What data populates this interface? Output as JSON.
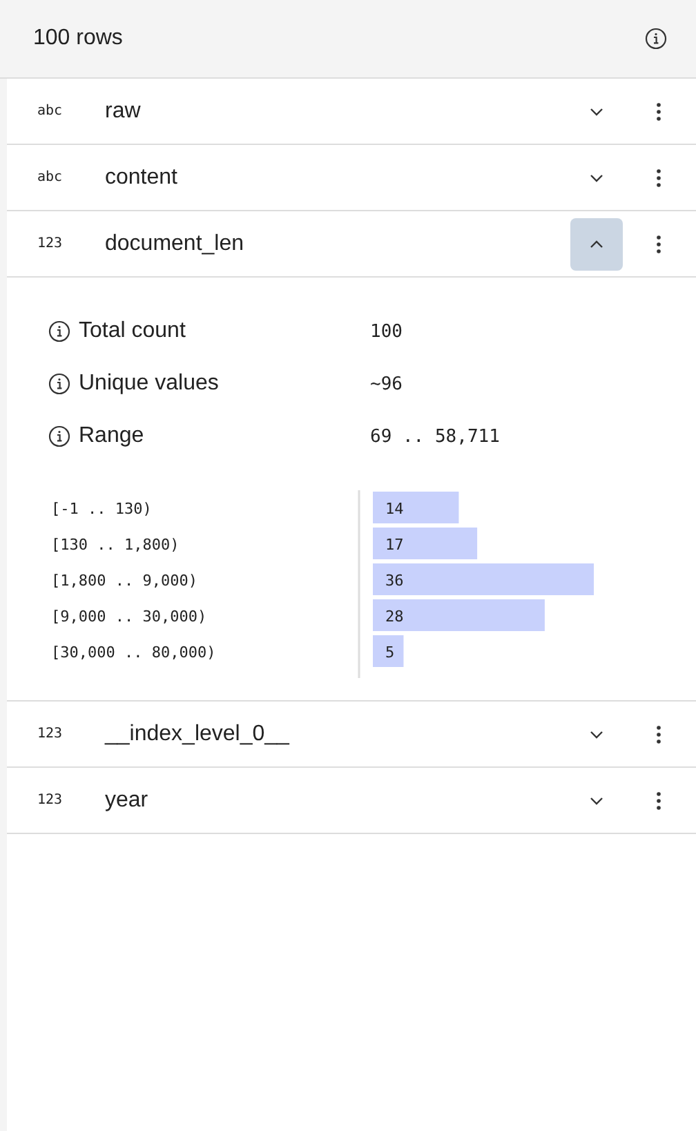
{
  "header": {
    "title": "100 rows"
  },
  "columns": [
    {
      "type_label": "abc",
      "name": "raw",
      "expanded": false
    },
    {
      "type_label": "abc",
      "name": "content",
      "expanded": false
    },
    {
      "type_label": "123",
      "name": "document_len",
      "expanded": true,
      "stats": [
        {
          "label": "Total count",
          "value": "100"
        },
        {
          "label": "Unique values",
          "value": "~96"
        },
        {
          "label": "Range",
          "value": "69 .. 58,711"
        }
      ],
      "chart_data": {
        "type": "bar",
        "orientation": "horizontal",
        "categories": [
          "[-1 .. 130)",
          "[130 .. 1,800)",
          "[1,800 .. 9,000)",
          "[9,000 .. 30,000)",
          "[30,000 .. 80,000)"
        ],
        "values": [
          14,
          17,
          36,
          28,
          5
        ],
        "data_labels": true
      }
    },
    {
      "type_label": "123",
      "name": "__index_level_0__",
      "expanded": false
    },
    {
      "type_label": "123",
      "name": "year",
      "expanded": false
    }
  ]
}
